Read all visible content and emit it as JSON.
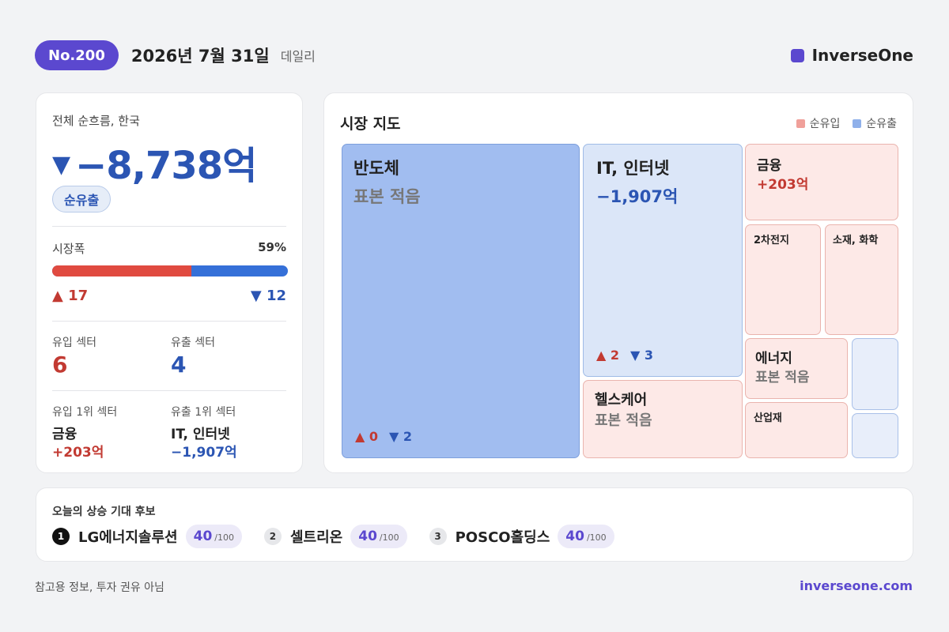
{
  "header": {
    "issue": "No.200",
    "date": "2026년 7월 31일",
    "frequency": "데일리",
    "brand": "InverseOne",
    "brand_color": "#5b48cf"
  },
  "summary": {
    "flow_label": "전체 순흐름, 한국",
    "flow_arrow": "▼",
    "flow_value": "−8,738억",
    "flow_status": "순유출",
    "breadth_label": "시장폭",
    "breadth_pct": "59%",
    "breadth_up_fraction": 0.59,
    "up_count": "▲ 17",
    "down_count": "▼ 12",
    "inflow_sectors_label": "유입 섹터",
    "inflow_sectors": "6",
    "outflow_sectors_label": "유출 섹터",
    "outflow_sectors": "4",
    "top_inflow_label": "유입 1위 섹터",
    "top_inflow_name": "금융",
    "top_inflow_value": "+203억",
    "top_outflow_label": "유출 1위 섹터",
    "top_outflow_name": "IT, 인터넷",
    "top_outflow_value": "−1,907억",
    "up_color": "#e04a40",
    "down_color": "#3570d8"
  },
  "market_map": {
    "title": "시장 지도",
    "legend_in": "순유입",
    "legend_out": "순유출",
    "legend_in_color": "#f0a09a",
    "legend_out_color": "#8fb0ea",
    "tiles": {
      "semis": {
        "name": "반도체",
        "sub": "표본 적음",
        "up": "▲ 0",
        "down": "▼ 2"
      },
      "it": {
        "name": "IT, 인터넷",
        "sub": "−1,907억",
        "up": "▲ 2",
        "down": "▼ 3"
      },
      "finance": {
        "name": "금융",
        "sub": "+203억"
      },
      "battery": {
        "name": "2차전지"
      },
      "materials": {
        "name": "소재, 화학"
      },
      "energy": {
        "name": "에너지",
        "sub": "표본 적음"
      },
      "healthcare": {
        "name": "헬스케어",
        "sub": "표본 적음"
      },
      "industrials": {
        "name": "산업재"
      }
    }
  },
  "candidates": {
    "title": "오늘의 상승 기대 후보",
    "items": [
      {
        "rank": "1",
        "name": "LG에너지솔루션",
        "score": "40",
        "max": "/100"
      },
      {
        "rank": "2",
        "name": "셀트리온",
        "score": "40",
        "max": "/100"
      },
      {
        "rank": "3",
        "name": "POSCO홀딩스",
        "score": "40",
        "max": "/100"
      }
    ]
  },
  "footer": {
    "disclaimer": "참고용 정보, 투자 권유 아님",
    "url": "inverseone.com"
  }
}
